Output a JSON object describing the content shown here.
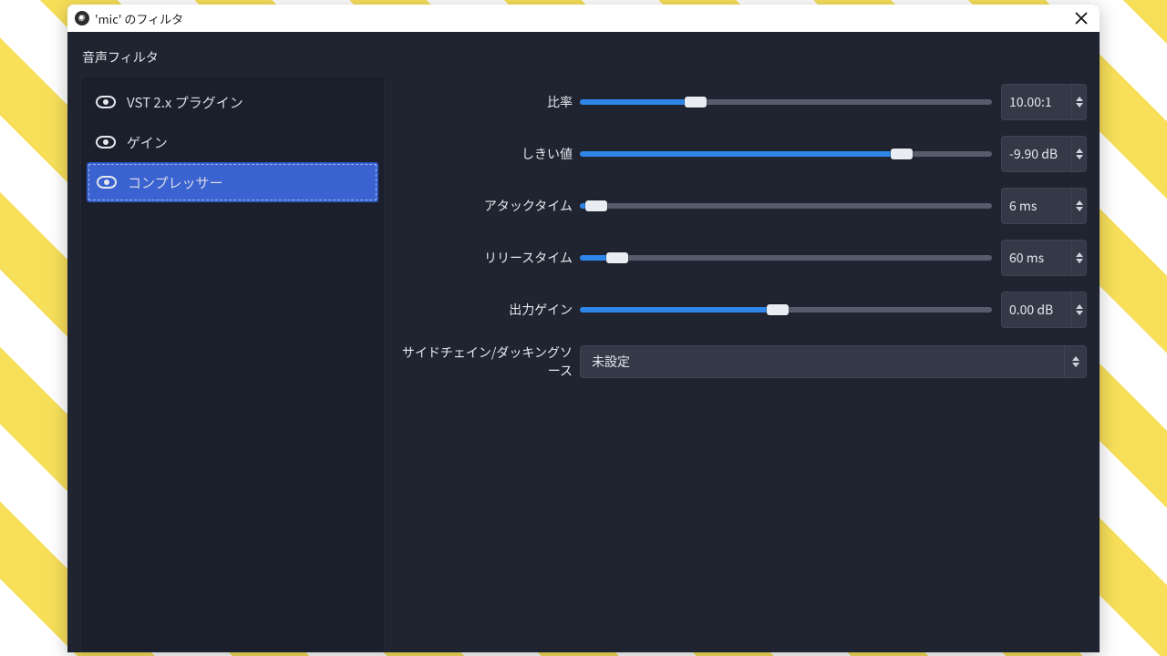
{
  "window": {
    "title": "'mic' のフィルタ"
  },
  "sidebar": {
    "heading": "音声フィルタ",
    "items": [
      {
        "label": "VST 2.x プラグイン",
        "selected": false
      },
      {
        "label": "ゲイン",
        "selected": false
      },
      {
        "label": "コンプレッサー",
        "selected": true
      }
    ]
  },
  "params": {
    "ratio": {
      "label": "比率",
      "value": "10.00:1",
      "fill_pct": 28
    },
    "threshold": {
      "label": "しきい値",
      "value": "-9.90 dB",
      "fill_pct": 78
    },
    "attack": {
      "label": "アタックタイム",
      "value": "6 ms",
      "fill_pct": 4
    },
    "release": {
      "label": "リリースタイム",
      "value": "60 ms",
      "fill_pct": 9
    },
    "outgain": {
      "label": "出力ゲイン",
      "value": "0.00 dB",
      "fill_pct": 48
    }
  },
  "sidechain": {
    "label": "サイドチェイン/ダッキングソース",
    "selected": "未設定"
  }
}
